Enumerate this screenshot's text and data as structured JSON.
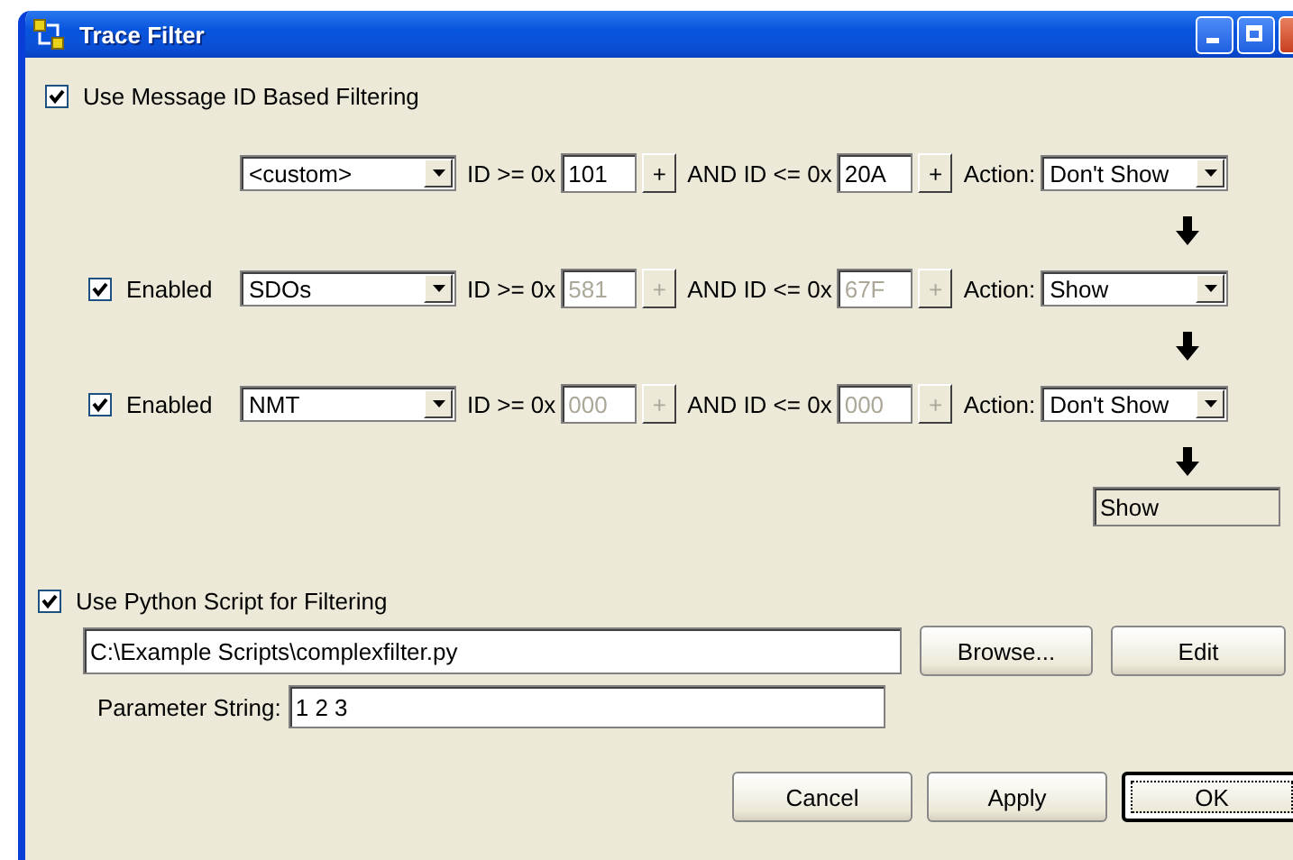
{
  "window": {
    "title": "Trace Filter"
  },
  "id_filtering": {
    "label": "Use Message ID Based Filtering",
    "checked": true
  },
  "filters": [
    {
      "kind": "custom",
      "preset": "<custom>",
      "min_label": "ID >= 0x",
      "min": "101",
      "min_step": "+",
      "max_label": "AND ID <= 0x",
      "max": "20A",
      "max_step": "+",
      "action_label": "Action:",
      "action": "Don't Show",
      "editable": true
    },
    {
      "kind": "preset",
      "enabled_label": "Enabled",
      "enabled": true,
      "preset": "SDOs",
      "min_label": "ID >= 0x",
      "min": "581",
      "min_step": "+",
      "max_label": "AND ID <= 0x",
      "max": "67F",
      "max_step": "+",
      "action_label": "Action:",
      "action": "Show",
      "editable": false
    },
    {
      "kind": "preset",
      "enabled_label": "Enabled",
      "enabled": true,
      "preset": "NMT",
      "min_label": "ID >= 0x",
      "min": "000",
      "min_step": "+",
      "max_label": "AND ID <= 0x",
      "max": "000",
      "max_step": "+",
      "action_label": "Action:",
      "action": "Don't Show",
      "editable": false
    }
  ],
  "default_action": {
    "value": "Show"
  },
  "script_filtering": {
    "label": "Use Python Script for Filtering",
    "checked": true,
    "path": "C:\\Example Scripts\\complexfilter.py",
    "browse": "Browse...",
    "edit": "Edit",
    "param_label": "Parameter String:",
    "param": "1 2 3"
  },
  "buttons": [
    {
      "label": "Cancel",
      "default": false
    },
    {
      "label": "Apply",
      "default": false
    },
    {
      "label": "OK",
      "default": true
    }
  ]
}
